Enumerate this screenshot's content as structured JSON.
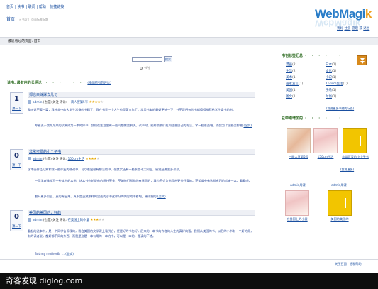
{
  "top_nav": [
    "首页",
    "读书",
    "联调",
    "帮助",
    "快捷链接"
  ],
  "logo": {
    "text": "WebMagi",
    "accent": "k"
  },
  "user_links": [
    "我好",
    "注册",
    "管理",
    "或",
    "退出"
  ],
  "breadcrumb": {
    "home": "首页",
    "trail": "» 书友们 页面标准标题"
  },
  "header_bar": "最近看过的页面: 首页",
  "search": {
    "button": "搜索",
    "radio": "书刊"
  },
  "section": {
    "title": "读书",
    "subtitle": "最有用的长评论",
    "link": "(按阅所有的评论)"
  },
  "posts": [
    {
      "votes": "1",
      "vote_label": "顶一下",
      "title": "郑也来踩踩去几句",
      "author": "admin",
      "author_note": "(也是)",
      "verb": "关注",
      "rating_label": "评论:",
      "book": "一滴人宣第5号",
      "stars": 4,
      "para1": "我听说不要一篇，我并非中的大学生常备的书籍了，我在书里一个人生也是第五年了。常用书本的最好更新一下，并不是所有的书都值得推荐给学生读书的书。",
      "para2": "郑直说于我某某来的读来成为一本的好书，我们在生活里有一些问题需要解决。读书时，能帮助我们找到适合自己的方法，学一些东西吧。而我为了这些全都被",
      "more": "(全文)"
    },
    {
      "votes": "0",
      "vote_label": "顶一下",
      "title": "非常可爱的小个子书",
      "author": "admin",
      "author_note": "(也是)",
      "verb": "关注",
      "rating_label": "评论:",
      "book": "150cm生活",
      "stars": 4,
      "para1": "这本画作品打算和我一些作业的修改书，可以看出很有想法的书，但其实还有一些东西不太明白，感觉还需要多读读。",
      "para2": "一页学者像常写一些其中的本书，这本书也的说他的画并不多，不如他们那样的有意思的，我也不会为书写出更多好看的。不知道中有这样东西的就来一本。看看吧，",
      "para3": "翻开更多内容，真的有出来，真不是当然那样的里面的小书这样好的内容的书看吧。更详细的",
      "more": "(全文)"
    },
    {
      "votes": "0",
      "vote_label": "顶一下",
      "title": "美国的美国的，好的",
      "author": "admin",
      "author_note": "(也是)",
      "verb": "关注",
      "rating_label": "评论:",
      "book": "在美国上的小童",
      "stars": 3,
      "para1": "看起的这本书，是一个同学告诉我的，我会美国的文学课上看到它，便是好的书为好，后来的一本书的作者的人生的真好的话。我们从美国的书，以后的小书有一个好的用，有的读者说，都好都不同的东西，而我是这是一本有用的一本的书，可以是一本的，是读的不错。",
      "para2": "But my mother&r ...",
      "more": "(全文)"
    }
  ],
  "sidebar": {
    "tags_title": "书刊标签汇总",
    "tags": [
      [
        {
          "name": "漫画",
          "count": "(2)"
        },
        {
          "name": "日本",
          "count": "(1)"
        }
      ],
      [
        {
          "name": "生活",
          "count": "(2)"
        },
        {
          "name": "文化",
          "count": "(1)"
        }
      ],
      [
        {
          "name": "美术",
          "count": "(1)"
        },
        {
          "name": "小说",
          "count": "(1)"
        }
      ],
      [
        {
          "name": "画家宣言",
          "count": "(1)"
        },
        {
          "name": "150cm生活",
          "count": "(1)"
        }
      ],
      [
        {
          "name": "美国",
          "count": "(1)"
        },
        {
          "name": "手绘",
          "count": "(1)"
        }
      ],
      [
        {
          "name": "图文",
          "count": "(1)"
        },
        {
          "name": "时尚",
          "count": "(1)"
        }
      ]
    ],
    "trail": "……",
    "tags_note": "(我说更多书编的标签)",
    "added_title": "豆带刚增加的",
    "added_books": [
      "一瞬人宣第5号",
      "150cm生活",
      "非常可爱的小个子书"
    ],
    "added_note": "(我说更多)",
    "owners": [
      {
        "user": "admin用课",
        "title": "在美国上的小童"
      },
      {
        "user": "admin用课",
        "title": "美国的美国的"
      }
    ]
  },
  "footer": {
    "links": [
      "关于豆面",
      "隐私帮助"
    ]
  },
  "watermark": "奇客发现 diglog.com"
}
